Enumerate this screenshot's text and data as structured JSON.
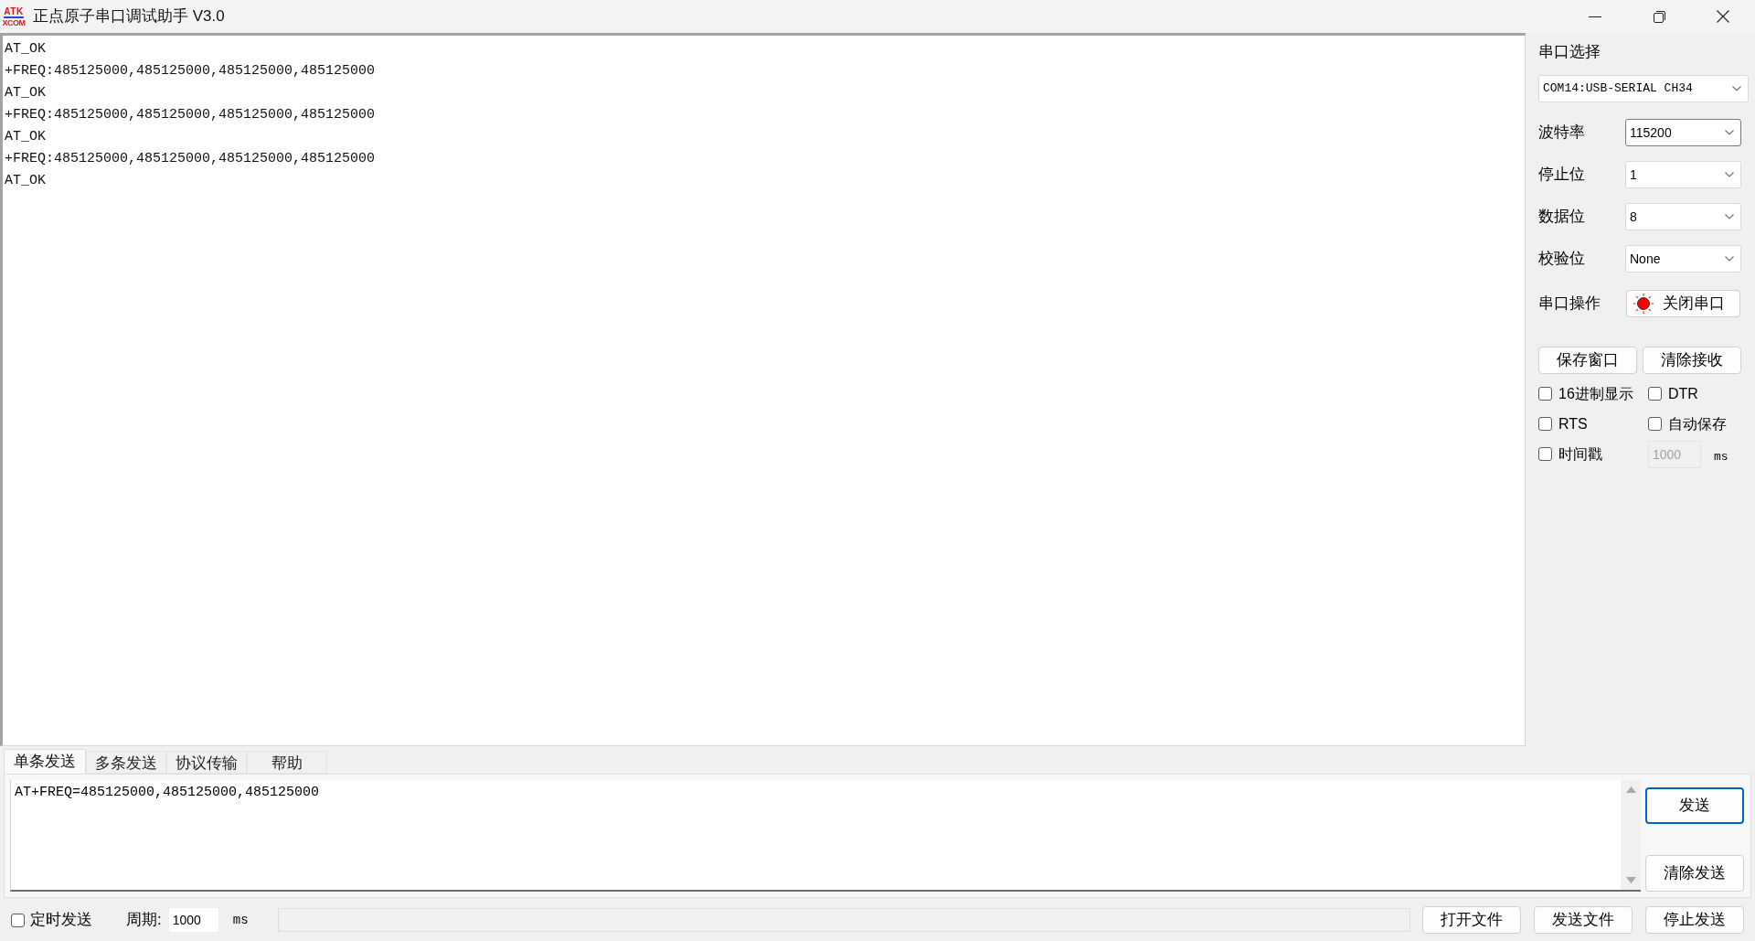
{
  "window": {
    "logo": [
      "ATK",
      "XCOM"
    ],
    "title": "正点原子串口调试助手 V3.0"
  },
  "receive_log": [
    "AT_OK",
    "+FREQ:485125000,485125000,485125000,485125000",
    "AT_OK",
    "+FREQ:485125000,485125000,485125000,485125000",
    "AT_OK",
    "+FREQ:485125000,485125000,485125000,485125000",
    "AT_OK"
  ],
  "serial_settings": {
    "port_label": "串口选择",
    "port": "COM14:USB-SERIAL CH34",
    "fields": [
      {
        "label": "波特率",
        "value": "115200",
        "focused": true
      },
      {
        "label": "停止位",
        "value": "1",
        "focused": false
      },
      {
        "label": "数据位",
        "value": "8",
        "focused": false
      },
      {
        "label": "校验位",
        "value": "None",
        "focused": false
      }
    ],
    "operation": {
      "label": "串口操作",
      "button": "关闭串口",
      "lamp_on": true
    }
  },
  "receive_buttons": [
    "保存窗口",
    "清除接收"
  ],
  "options": [
    {
      "label": "16进制显示",
      "checked": false
    },
    {
      "label": "DTR",
      "checked": false
    },
    {
      "label": "RTS",
      "checked": false
    },
    {
      "label": "自动保存",
      "checked": false
    },
    {
      "label": "时间戳",
      "checked": false
    }
  ],
  "timestamp_interval": {
    "value": "1000",
    "unit": "ms",
    "disabled": true
  },
  "send_tabs": [
    {
      "label": "单条发送",
      "selected": true
    },
    {
      "label": "多条发送",
      "selected": false
    },
    {
      "label": "协议传输",
      "selected": false
    },
    {
      "label": "帮助",
      "selected": false
    }
  ],
  "send_text": "AT+FREQ=485125000,485125000,485125000",
  "send_buttons": [
    {
      "label": "发送",
      "focused": true
    },
    {
      "label": "清除发送",
      "focused": false
    }
  ],
  "timed_send": {
    "label": "定时发送",
    "checked": false,
    "period_label": "周期:",
    "period": "1000",
    "unit": "ms"
  },
  "file_buttons": [
    "打开文件",
    "发送文件",
    "停止发送"
  ]
}
